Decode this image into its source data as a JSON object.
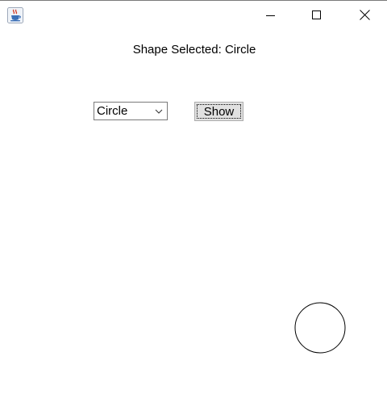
{
  "window": {
    "controls": {
      "minimize_icon": "minimize-icon",
      "maximize_icon": "maximize-icon",
      "close_icon": "close-icon"
    },
    "app_icon": "java-coffee-cup-icon"
  },
  "status": {
    "text": "Shape Selected: Circle"
  },
  "shape_select": {
    "selected": "Circle"
  },
  "toolbar": {
    "show_label": "Show"
  },
  "drawing": {
    "shape": "circle",
    "stroke_color": "#000000"
  }
}
